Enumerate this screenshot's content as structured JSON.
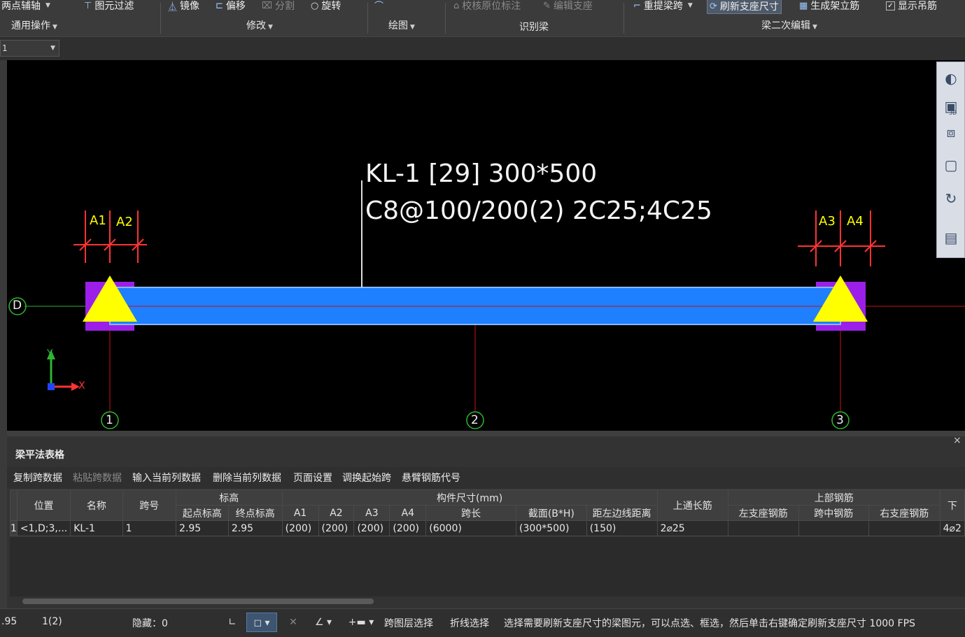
{
  "ribbon": {
    "items": {
      "point_axis": "两点辅轴",
      "element_filter": "图元过滤",
      "mirror": "镜像",
      "offset": "偏移",
      "split": "分割",
      "rotate": "旋转",
      "check_original_label": "校核原位标注",
      "edit_support": "编辑支座",
      "re_extract_span": "重提梁跨",
      "refresh_support_size": "刷新支座尺寸",
      "generate_stand_rebar": "生成架立筋",
      "show_hanger_rebar": "显示吊筋"
    },
    "groups": {
      "general_ops": "通用操作",
      "modify": "修改",
      "draw": "绘图",
      "identify_beam": "识别梁",
      "beam_secondary_edit": "梁二次编辑"
    }
  },
  "toolbar2": {
    "combo_value": "1"
  },
  "canvas": {
    "beam_label_line1": "KL-1 [29] 300*500",
    "beam_label_line2": "C8@100/200(2) 2C25;4C25",
    "dims": [
      "A1",
      "A2",
      "A3",
      "A4"
    ],
    "axis_row": "D",
    "axis_cols": [
      "1",
      "2",
      "3"
    ],
    "ucs_x": "X",
    "ucs_y": "Y",
    "colors": {
      "beam": "#1e7fff",
      "support": "#9b1fe8",
      "triangle": "#ffff00",
      "axis": "#cc1111",
      "bubble": "#2fb52f",
      "dim": "#ff3333"
    }
  },
  "viewcube": {
    "icons": [
      "orbit-icon",
      "3d-view-icon",
      "top-view-icon",
      "box-view-icon",
      "rotate-icon",
      "view-settings-icon"
    ],
    "label_3d": "3D"
  },
  "panel": {
    "title": "梁平法表格",
    "close": "×",
    "toolbar": [
      "复制跨数据",
      "粘贴跨数据",
      "输入当前列数据",
      "删除当前列数据",
      "页面设置",
      "调换起始跨",
      "悬臂钢筋代号"
    ],
    "headers": {
      "position": "位置",
      "name": "名称",
      "span_no": "跨号",
      "elevation": "标高",
      "start_elev": "起点标高",
      "end_elev": "终点标高",
      "member_size": "构件尺寸(mm)",
      "a1": "A1",
      "a2": "A2",
      "a3": "A3",
      "a4": "A4",
      "span_len": "跨长",
      "section": "截面(B*H)",
      "dist_left": "距左边线距离",
      "top_through": "上通长筋",
      "top_rebar": "上部钢筋",
      "left_support": "左支座钢筋",
      "mid_span": "跨中钢筋",
      "right_support": "右支座钢筋",
      "bottom_cut": "下"
    },
    "row": {
      "index": "1",
      "position": "<1,D;3,...",
      "name": "KL-1",
      "span_no": "1",
      "start_elev": "2.95",
      "end_elev": "2.95",
      "a1": "(200)",
      "a2": "(200)",
      "a3": "(200)",
      "a4": "(200)",
      "span_len": "(6000)",
      "section": "(300*500)",
      "dist_left": "(150)",
      "top_through": "2⌀25",
      "left_support": "",
      "mid_span": "",
      "right_support": "",
      "bottom_cut": "4⌀2"
    }
  },
  "status": {
    "coord": ".95",
    "layer": "1(2)",
    "hidden": "隐藏：0",
    "cross_layer_select": "跨图层选择",
    "polyline_select": "折线选择",
    "message": "选择需要刷新支座尺寸的梁图元，可以点选、框选，然后单击右键确定刷新支座尺寸 1000 FPS"
  }
}
